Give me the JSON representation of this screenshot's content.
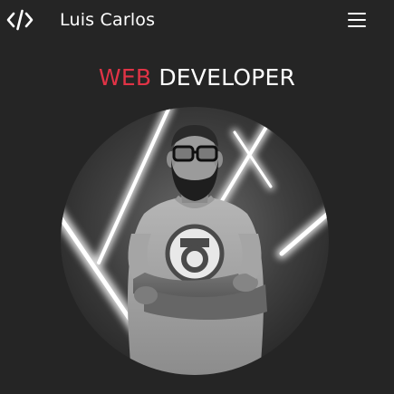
{
  "header": {
    "brand_name": "Luis Carlos",
    "logo_icon": "code-brackets-icon",
    "menu_icon": "hamburger-menu-icon"
  },
  "hero": {
    "title_accent": "WEB",
    "title_rest": "DEVELOPER",
    "photo_alt": "Luis Carlos"
  },
  "colors": {
    "background": "#252525",
    "accent": "#e03346",
    "text": "#ffffff"
  }
}
